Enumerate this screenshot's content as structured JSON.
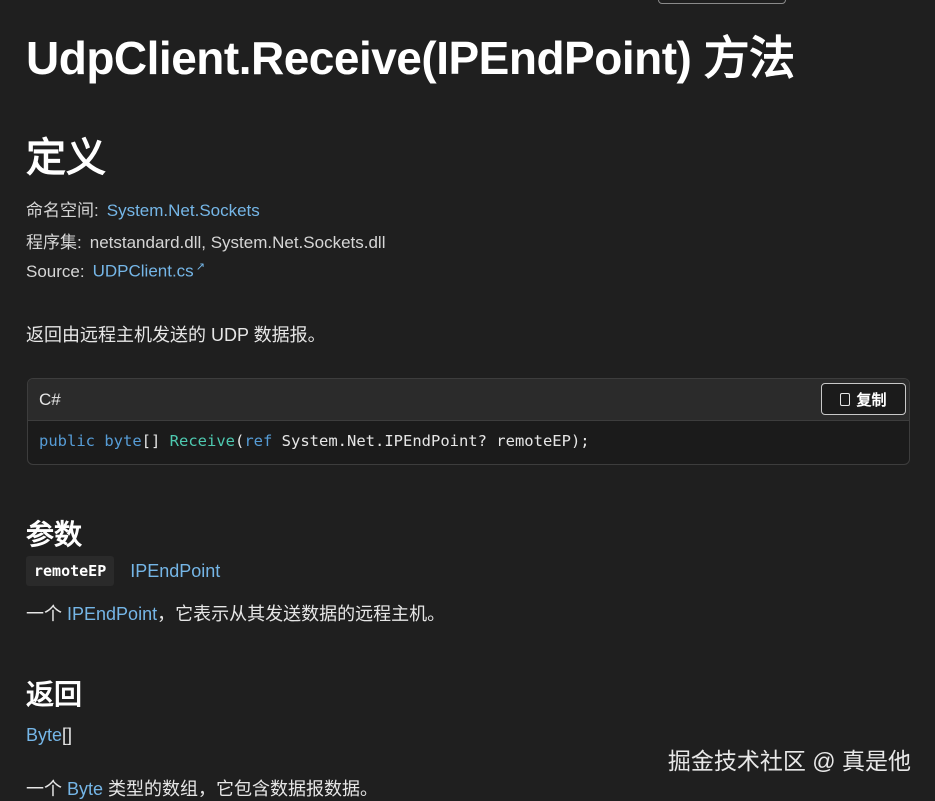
{
  "title": "UdpClient.Receive(IPEndPoint) 方法",
  "definition": {
    "heading": "定义",
    "namespace_label": "命名空间:",
    "namespace_value": "System.Net.Sockets",
    "assembly_label": "程序集:",
    "assembly_value": "netstandard.dll, System.Net.Sockets.dll",
    "source_label": "Source:",
    "source_value": "UDPClient.cs",
    "source_icon": "external-link-icon"
  },
  "summary": "返回由远程主机发送的 UDP 数据报。",
  "code": {
    "language": "C#",
    "copy_label": "复制",
    "copy_icon": "copy-icon",
    "tokens": {
      "public": "public",
      "byte": "byte",
      "brackets": "[] ",
      "receive": "Receive",
      "open": "(",
      "ref": "ref",
      "rest": " System.Net.IPEndPoint? remoteEP);"
    }
  },
  "parameters": {
    "heading": "参数",
    "name": "remoteEP",
    "type": "IPEndPoint",
    "desc_prefix": "一个 ",
    "desc_link": "IPEndPoint",
    "desc_suffix": "，它表示从其发送数据的远程主机。"
  },
  "returns": {
    "heading": "返回",
    "type_link": "Byte",
    "type_suffix": "[]",
    "desc_prefix": "一个 ",
    "desc_link": "Byte",
    "desc_suffix": " 类型的数组，它包含数据报数据。"
  },
  "watermark": "掘金技术社区 @ 真是他"
}
